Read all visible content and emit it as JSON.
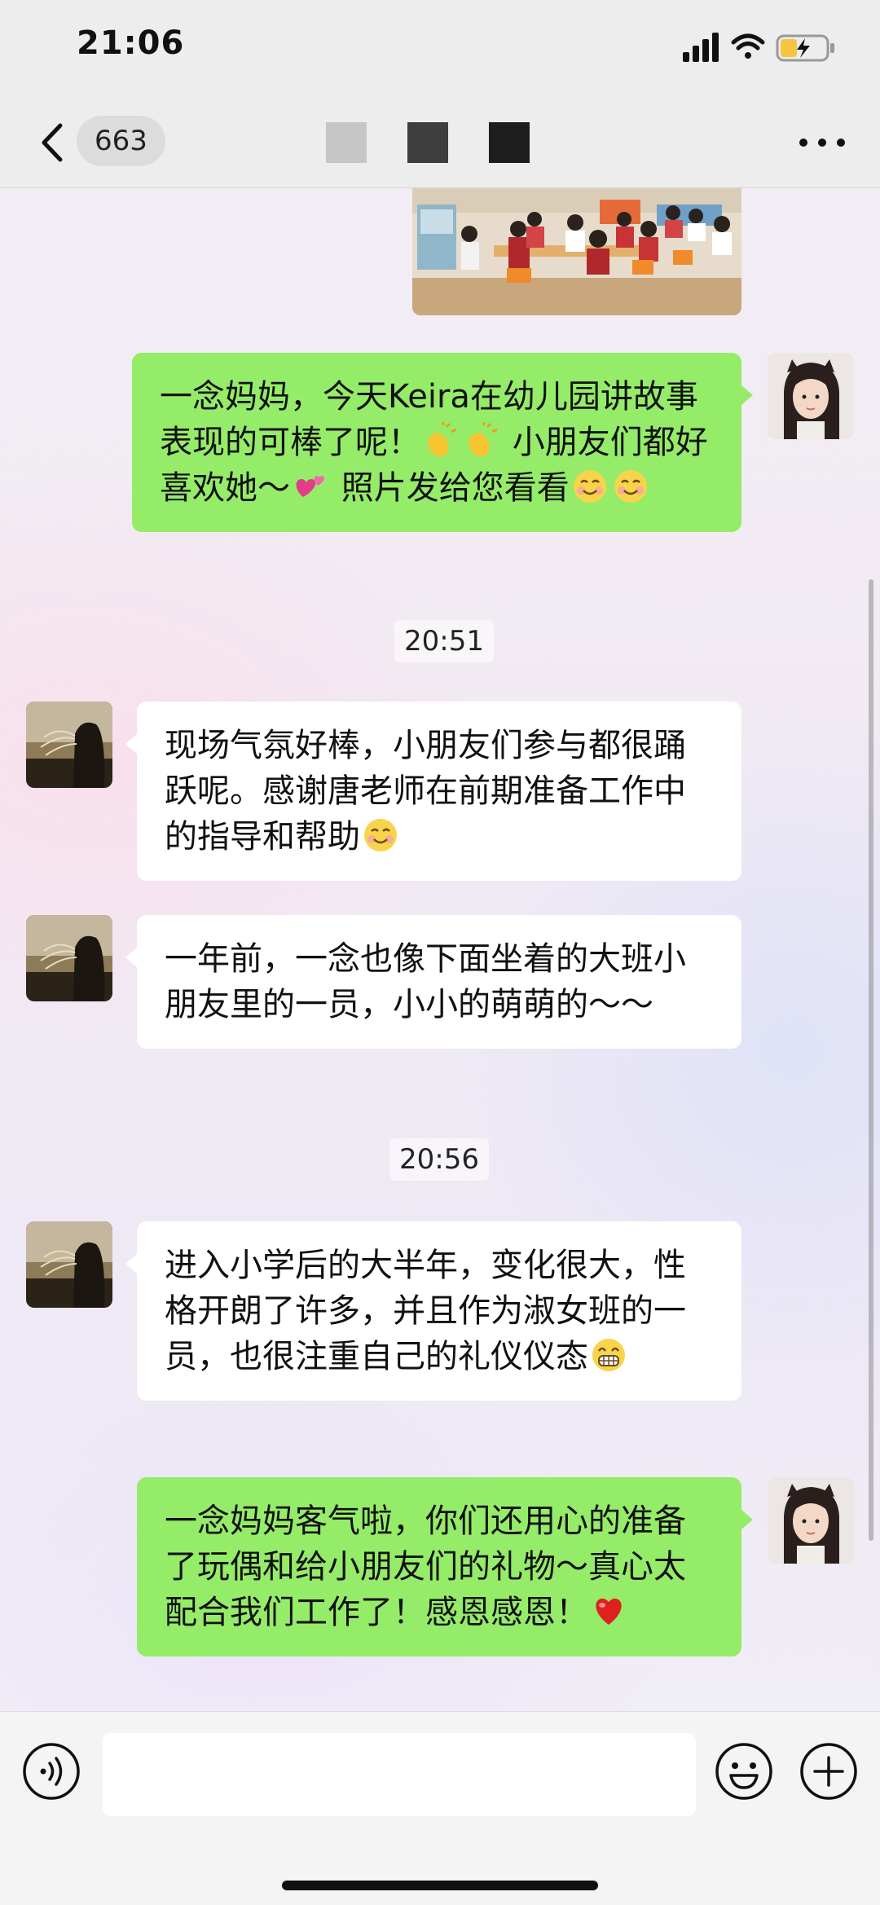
{
  "status_bar": {
    "time": "21:06"
  },
  "nav": {
    "unread_count": "663"
  },
  "messages": [
    {
      "side": "right",
      "text": "一念妈妈，今天Keira在幼儿园讲故事表现的可棒了呢！",
      "text2": "小朋友们都好喜欢她～",
      "text3": "照片发给您看看"
    },
    {
      "side": "left",
      "text": "现场气氛好棒，小朋友们参与都很踊跃呢。感谢唐老师在前期准备工作中的指导和帮助"
    },
    {
      "side": "left",
      "text": "一年前，一念也像下面坐着的大班小朋友里的一员，小小的萌萌的～～"
    },
    {
      "side": "left",
      "text": "进入小学后的大半年，变化很大，性格开朗了许多，并且作为淑女班的一员，也很注重自己的礼仪仪态"
    },
    {
      "side": "right",
      "text": "一念妈妈客气啦，你们还用心的准备了玩偶和给小朋友们的礼物～真心太配合我们工作了！感恩感恩！"
    }
  ],
  "timestamps": [
    "20:51",
    "20:56"
  ],
  "colors": {
    "sent_bubble": "#95ec69",
    "received_bubble": "#ffffff",
    "bar_background": "#ededed"
  },
  "icons": {
    "back": "chevron-left-icon",
    "more": "more-dots-icon",
    "voice": "voice-icon",
    "emoji": "emoji-icon",
    "plus": "plus-icon"
  }
}
